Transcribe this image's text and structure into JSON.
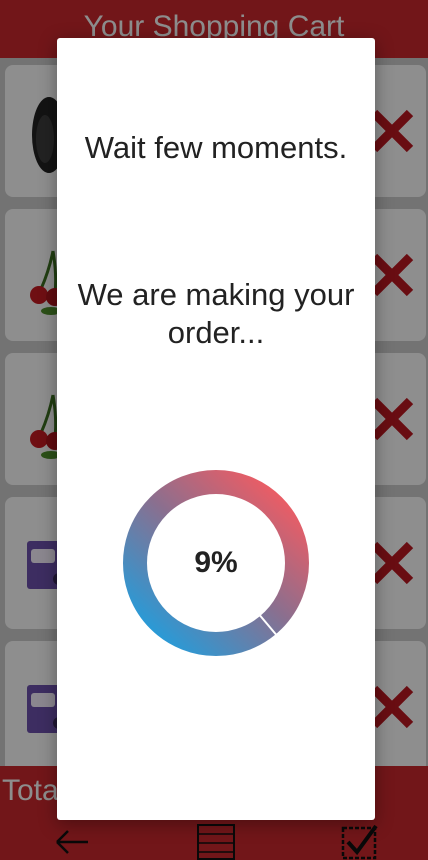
{
  "header": {
    "title": "Your Shopping Cart"
  },
  "cart": {
    "items": [
      {
        "thumb": "avocado-icon"
      },
      {
        "thumb": "cherries-icon"
      },
      {
        "thumb": "cherries-icon"
      },
      {
        "thumb": "chocolate-bar-icon"
      },
      {
        "thumb": "chocolate-bar-icon"
      }
    ],
    "remove_icon": "close-icon"
  },
  "footer": {
    "total_label": "Total",
    "nav": [
      "back-arrow-icon",
      "list-icon",
      "checkout-check-icon"
    ]
  },
  "dialog": {
    "line1": "Wait few moments.",
    "line2": "We are making your order...",
    "progress": {
      "value": 9,
      "label": "9%"
    }
  },
  "colors": {
    "brand_red": "#c4262b",
    "remove_red": "#b61820",
    "ring_gradient": [
      "#f45b61",
      "#8a6f8f",
      "#2a9ad6"
    ]
  }
}
